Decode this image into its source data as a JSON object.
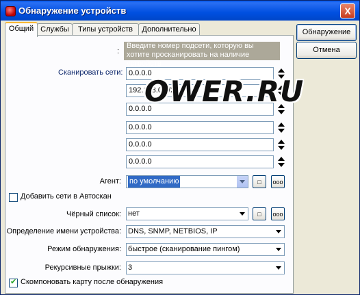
{
  "window": {
    "title": "Обнаружение устройств",
    "close": "X"
  },
  "tabs": [
    "Общий",
    "Службы",
    "Типы устройств",
    "Дополнительно"
  ],
  "buttons": {
    "discover": "Обнаружение",
    "cancel": "Отмена"
  },
  "form": {
    "colon_label": ":",
    "hint": "Введите номер подсети, которую вы хотите просканировать на наличие устройств",
    "scan_label": "Сканировать сети:",
    "networks": [
      "0.0.0.0",
      "192.168.0.0/24",
      "0.0.0.0",
      "0.0.0.0",
      "0.0.0.0",
      "0.0.0.0"
    ],
    "agent_label": "Агент:",
    "agent_value": "по умолчанию",
    "add_autoscan": "Добавить сети в Автоскан",
    "blacklist_label": "Чёрный список:",
    "blacklist_value": "нет",
    "name_label": "Определение имени устройства:",
    "name_value": "DNS, SNMP, NETBIOS, IP",
    "mode_label": "Режим обнаружения:",
    "mode_value": "быстрое (сканирование пингом)",
    "hops_label": "Рекурсивные прыжки:",
    "hops_value": "3",
    "arrange_map": "Скомпоновать карту после обнаружения",
    "small_btn": "□",
    "dots_btn": "ooo"
  },
  "watermark": "OWER.RU",
  "colors": {
    "titlebar": "#0054e3",
    "hint_bg": "#aca899",
    "selection": "#316ac5"
  }
}
